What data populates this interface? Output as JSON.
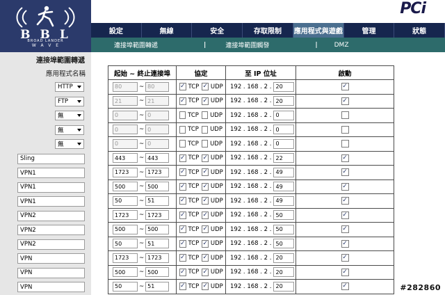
{
  "header": {
    "logo_text": "BBL",
    "logo_sub1": "BROAD LANDER",
    "logo_sub2": "WAVE",
    "brand": "PCi"
  },
  "nav": {
    "items": [
      {
        "label": "設定",
        "active": false
      },
      {
        "label": "無線",
        "active": false
      },
      {
        "label": "安全",
        "active": false
      },
      {
        "label": "存取限制",
        "active": false
      },
      {
        "label": "應用程式與遊戲",
        "active": true
      },
      {
        "label": "管理",
        "active": false
      },
      {
        "label": "狀態",
        "active": false
      }
    ]
  },
  "subnav": {
    "items": [
      "連接埠範圍轉遞",
      "連接埠範圍觸發",
      "DMZ"
    ],
    "separator": "|"
  },
  "left": {
    "section_title": "連接埠範圍轉遞",
    "app_name_label": "應用程式名稱"
  },
  "table": {
    "headers": {
      "range": "起始 ~ 終止連接埠",
      "protocol": "協定",
      "ip": "至 IP 位址",
      "enable": "啟動"
    },
    "tilde": "~",
    "tcp_label": "TCP",
    "udp_label": "UDP",
    "ip_prefix": "192 . 168 . 2 .",
    "rows": [
      {
        "app": "HTTP",
        "app_type": "select",
        "start": "80",
        "end": "80",
        "disabled": true,
        "tcp": true,
        "udp": true,
        "ip": "20",
        "enabled": true
      },
      {
        "app": "FTP",
        "app_type": "select",
        "start": "21",
        "end": "21",
        "disabled": true,
        "tcp": true,
        "udp": true,
        "ip": "20",
        "enabled": true
      },
      {
        "app": "無",
        "app_type": "select",
        "start": "0",
        "end": "0",
        "disabled": true,
        "tcp": false,
        "udp": false,
        "ip": "0",
        "enabled": false
      },
      {
        "app": "無",
        "app_type": "select",
        "start": "0",
        "end": "0",
        "disabled": true,
        "tcp": false,
        "udp": false,
        "ip": "0",
        "enabled": false
      },
      {
        "app": "無",
        "app_type": "select",
        "start": "0",
        "end": "0",
        "disabled": true,
        "tcp": false,
        "udp": false,
        "ip": "0",
        "enabled": false
      },
      {
        "app": "Sling",
        "app_type": "text",
        "start": "443",
        "end": "443",
        "disabled": false,
        "tcp": true,
        "udp": true,
        "ip": "22",
        "enabled": true
      },
      {
        "app": "VPN1",
        "app_type": "text",
        "start": "1723",
        "end": "1723",
        "disabled": false,
        "tcp": true,
        "udp": true,
        "ip": "49",
        "enabled": true
      },
      {
        "app": "VPN1",
        "app_type": "text",
        "start": "500",
        "end": "500",
        "disabled": false,
        "tcp": true,
        "udp": true,
        "ip": "49",
        "enabled": true
      },
      {
        "app": "VPN1",
        "app_type": "text",
        "start": "50",
        "end": "51",
        "disabled": false,
        "tcp": true,
        "udp": true,
        "ip": "49",
        "enabled": true
      },
      {
        "app": "VPN2",
        "app_type": "text",
        "start": "1723",
        "end": "1723",
        "disabled": false,
        "tcp": true,
        "udp": true,
        "ip": "50",
        "enabled": true
      },
      {
        "app": "VPN2",
        "app_type": "text",
        "start": "500",
        "end": "500",
        "disabled": false,
        "tcp": true,
        "udp": true,
        "ip": "50",
        "enabled": true
      },
      {
        "app": "VPN2",
        "app_type": "text",
        "start": "50",
        "end": "51",
        "disabled": false,
        "tcp": true,
        "udp": true,
        "ip": "50",
        "enabled": true
      },
      {
        "app": "VPN",
        "app_type": "text",
        "start": "1723",
        "end": "1723",
        "disabled": false,
        "tcp": true,
        "udp": true,
        "ip": "20",
        "enabled": true
      },
      {
        "app": "VPN",
        "app_type": "text",
        "start": "500",
        "end": "500",
        "disabled": false,
        "tcp": true,
        "udp": true,
        "ip": "20",
        "enabled": true
      },
      {
        "app": "VPN",
        "app_type": "text",
        "start": "50",
        "end": "51",
        "disabled": false,
        "tcp": true,
        "udp": true,
        "ip": "20",
        "enabled": true
      }
    ]
  },
  "watermark": "#282860",
  "colors": {
    "logo_bg": "#2b3a6b",
    "nav_bg": "#16264e",
    "nav_active": "#4b6f8f",
    "subnav_bg": "#2d6b6b",
    "left_bg": "#e6e6e6"
  }
}
